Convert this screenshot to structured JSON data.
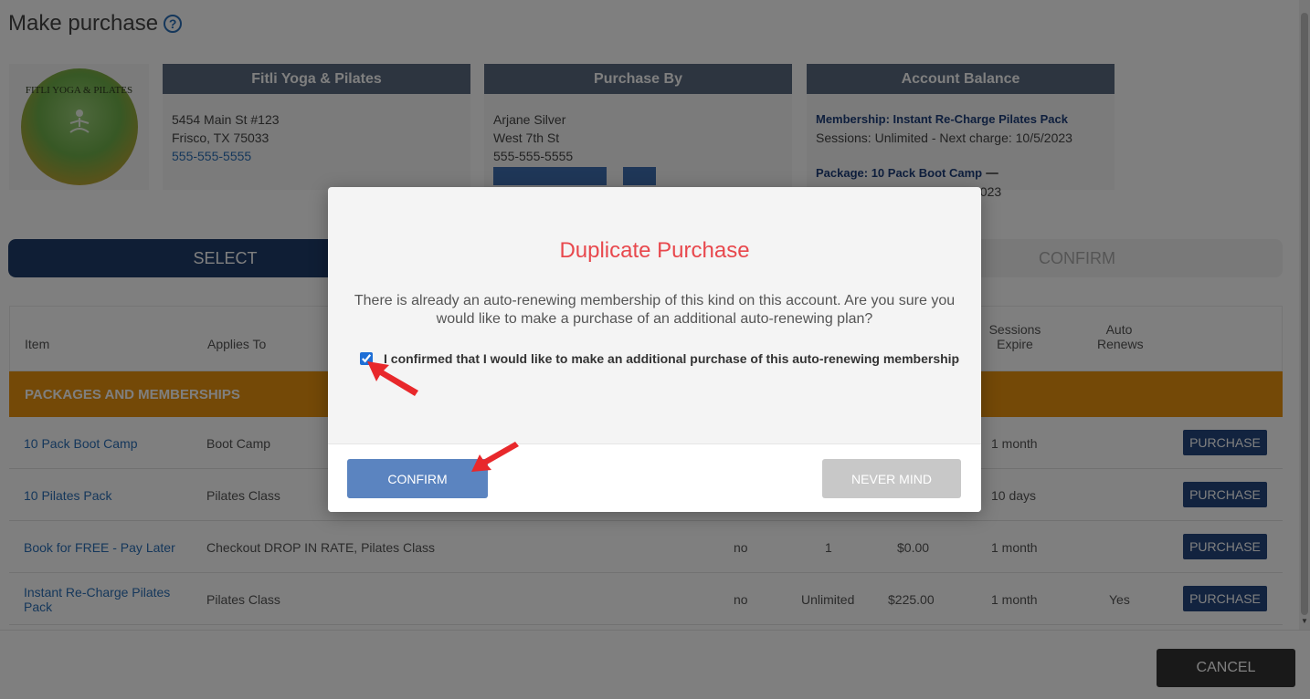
{
  "page": {
    "title": "Make purchase",
    "help_icon": "question-circle-icon"
  },
  "studio_card": {
    "heading": "Fitli Yoga & Pilates",
    "address1": "5454 Main St #123",
    "address2": "Frisco, TX 75033",
    "phone": "555-555-5555",
    "logo_text": "FITLI YOGA & PILATES"
  },
  "purchaser_card": {
    "heading": "Purchase By",
    "name": "Arjane Silver",
    "street": "West 7th St",
    "phone": "555-555-5555"
  },
  "balance_card": {
    "heading": "Account Balance",
    "membership_label": "Membership: Instant Re-Charge Pilates Pack",
    "membership_detail": "Sessions: Unlimited - Next charge: 10/5/2023",
    "package_label": "Package: 10 Pack Boot Camp",
    "package_badge": "",
    "package_detail_tail": "2023"
  },
  "steps": {
    "select": "SELECT",
    "confirm": "CONFIRM"
  },
  "table": {
    "headers": {
      "item": "Item",
      "applies_to": "Applies To",
      "sessions_expire": "Sessions Expire",
      "auto_renews": "Auto Renews"
    },
    "section_title": "PACKAGES AND MEMBERSHIPS",
    "purchase_label": "PURCHASE",
    "rows": [
      {
        "item": "10 Pack Boot Camp",
        "applies_to": "Boot Camp",
        "taxable": "",
        "sessions": "",
        "price": "",
        "expire": "1 month",
        "auto_renews": ""
      },
      {
        "item": "10 Pilates Pack",
        "applies_to": "Pilates Class",
        "taxable": "",
        "sessions": "",
        "price": "",
        "expire": "10 days",
        "auto_renews": ""
      },
      {
        "item": "Book for FREE - Pay Later",
        "applies_to": "Checkout DROP IN RATE, Pilates Class",
        "taxable": "no",
        "sessions": "1",
        "price": "$0.00",
        "expire": "1 month",
        "auto_renews": ""
      },
      {
        "item": "Instant Re-Charge Pilates Pack",
        "applies_to": "Pilates Class",
        "taxable": "no",
        "sessions": "Unlimited",
        "price": "$225.00",
        "expire": "1 month",
        "auto_renews": "Yes"
      }
    ]
  },
  "footer": {
    "cancel_label": "CANCEL"
  },
  "modal": {
    "title": "Duplicate Purchase",
    "message": "There is already an auto-renewing membership of this kind on this account. Are you sure you would like to make a purchase of an additional auto-renewing plan?",
    "checkbox_label": "I confirmed that I would like to make an additional purchase of this auto-renewing membership",
    "checkbox_checked": true,
    "confirm_label": "CONFIRM",
    "nevermind_label": "NEVER MIND"
  },
  "colors": {
    "accent_red": "#e8484d",
    "navy": "#1f3d6b",
    "orange_section": "#e8930f",
    "confirm_blue": "#5b84c0"
  }
}
